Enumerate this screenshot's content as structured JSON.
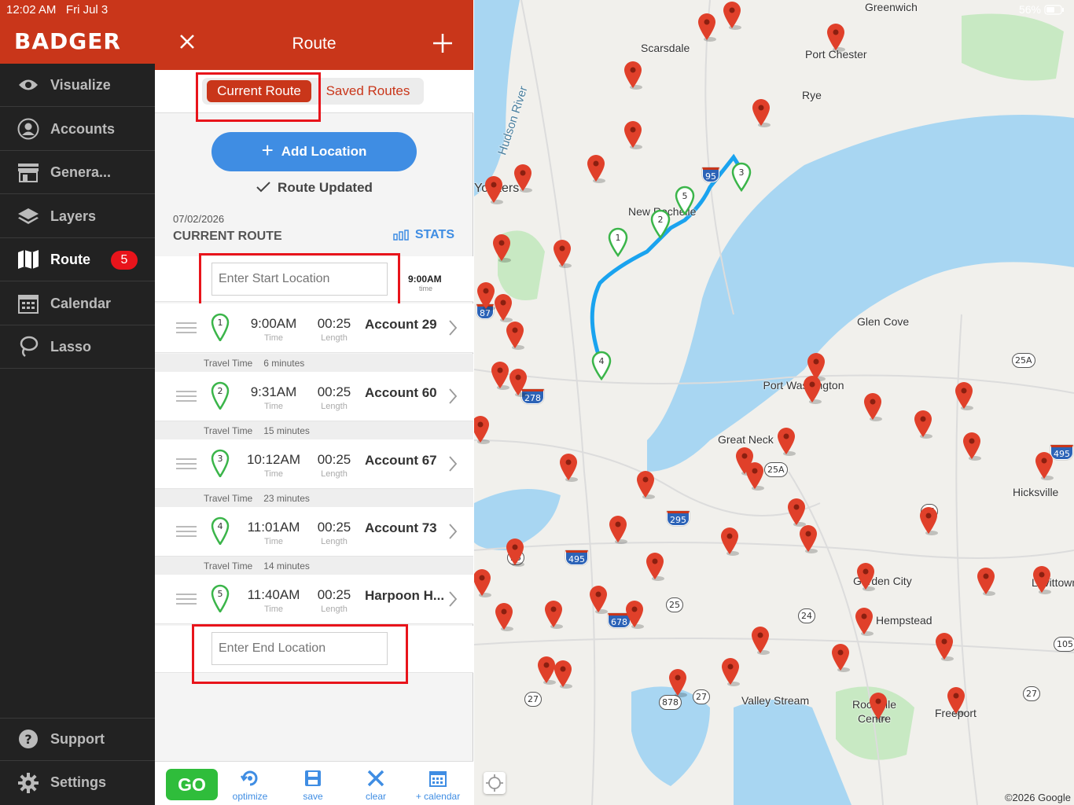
{
  "status": {
    "time": "12:02 AM",
    "date": "Fri Jul 3",
    "battery": "56%"
  },
  "brand": "BADGER",
  "sidebar": {
    "items": [
      {
        "label": "Visualize",
        "icon": "eye-icon"
      },
      {
        "label": "Accounts",
        "icon": "user-icon"
      },
      {
        "label": "Genera...",
        "icon": "store-icon"
      },
      {
        "label": "Layers",
        "icon": "layers-icon"
      },
      {
        "label": "Route",
        "icon": "map-icon",
        "badge": "5"
      },
      {
        "label": "Calendar",
        "icon": "calendar-icon"
      },
      {
        "label": "Lasso",
        "icon": "lasso-icon"
      }
    ],
    "support": "Support",
    "settings": "Settings"
  },
  "panel": {
    "title": "Route",
    "tabs": {
      "current": "Current Route",
      "saved": "Saved Routes"
    },
    "add_location": "Add Location",
    "route_updated": "Route Updated",
    "date": "07/02/2026",
    "heading": "CURRENT ROUTE",
    "stats": "STATS",
    "start_placeholder": "Enter Start Location",
    "start_time": "9:00AM",
    "start_time_sub": "time",
    "end_placeholder": "Enter End Location",
    "time_sub": "Time",
    "length_sub": "Length",
    "travel_label": "Travel Time",
    "stops": [
      {
        "num": "1",
        "time": "9:00AM",
        "length": "00:25",
        "name": "Account 29",
        "travel": "6 minutes"
      },
      {
        "num": "2",
        "time": "9:31AM",
        "length": "00:25",
        "name": "Account 60",
        "travel": "15 minutes"
      },
      {
        "num": "3",
        "time": "10:12AM",
        "length": "00:25",
        "name": "Account 67",
        "travel": "23 minutes"
      },
      {
        "num": "4",
        "time": "11:01AM",
        "length": "00:25",
        "name": "Account 73",
        "travel": "14 minutes"
      },
      {
        "num": "5",
        "time": "11:40AM",
        "length": "00:25",
        "name": "Harpoon H..."
      }
    ]
  },
  "toolbar": {
    "go": "GO",
    "optimize": "optimize",
    "save": "save",
    "clear": "clear",
    "calendar": "+ calendar"
  },
  "map": {
    "labels": [
      "Greenwich",
      "Scarsdale",
      "Port Chester",
      "Rye",
      "Hudson River",
      "Yonkers",
      "New Rochelle",
      "Glen Cove",
      "Port Washington",
      "Great Neck",
      "Hicksville",
      "Garden City",
      "Levittown",
      "Hempstead",
      "Valley Stream",
      "Rockville Centre",
      "Freeport"
    ],
    "shields": [
      "95",
      "87",
      "278",
      "295",
      "495",
      "678",
      "25A",
      "25",
      "24",
      "878",
      "27",
      "105"
    ],
    "copyright": "©2026 Google",
    "route_color": "#1aa3ef",
    "pin_color": "#e0402a",
    "stop_pin_color": "#3bb54a"
  }
}
